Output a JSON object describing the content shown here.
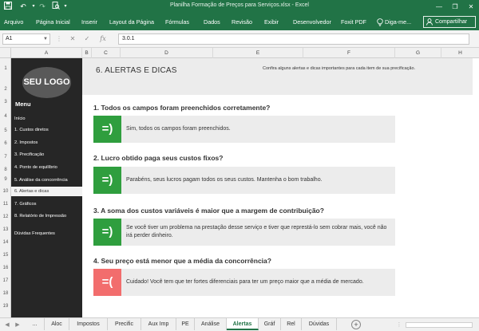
{
  "window": {
    "title": "Planilha Formação de Preços para Serviços.xlsx - Excel",
    "minimize": "—",
    "restore": "❐",
    "close": "✕"
  },
  "ribbon": {
    "tabs": [
      "Arquivo",
      "Página Inicial",
      "Inserir",
      "Layout da Página",
      "Fórmulas",
      "Dados",
      "Revisão",
      "Exibir",
      "Desenvolvedor",
      "Foxit PDF",
      "Diga-me..."
    ],
    "share_label": "Compartilhar"
  },
  "formula_bar": {
    "name_box": "A1",
    "value": "3.0.1"
  },
  "columns": [
    "A",
    "B",
    "C",
    "D",
    "E",
    "F",
    "G",
    "H"
  ],
  "rows": [
    "1",
    "2",
    "3",
    "4",
    "5",
    "6",
    "7",
    "8",
    "9",
    "10",
    "11",
    "12",
    "13",
    "14",
    "15",
    "16",
    "17",
    "18",
    "19"
  ],
  "menu": {
    "logo": "SEU LOGO",
    "title": "Menu",
    "items": [
      "Início",
      "1. Custos diretos",
      "2. Impostos",
      "3. Precificação",
      "4. Ponto de equilíbrio",
      "5. Análise da concorrência",
      "6. Alertas e dicas",
      "7. Gráficos",
      "8. Relatório de Impressão",
      "Dúvidas Frequentes"
    ]
  },
  "header": {
    "title": "6. ALERTAS E DICAS",
    "subtitle": "Confira alguns alertas e dicas importantes para cada item de sua precificação."
  },
  "alerts": [
    {
      "question": "1. Todos os campos foram preenchidos corretamente?",
      "badge": "=)",
      "status": "ok",
      "answer": "Sim, todos os campos foram preenchidos."
    },
    {
      "question": "2. Lucro obtido paga seus custos fixos?",
      "badge": "=)",
      "status": "ok",
      "answer": "Parabéns, seus lucros pagam todos os seus custos. Mantenha o bom trabalho."
    },
    {
      "question": "3. A soma dos custos variáveis é maior que a margem de contribuição?",
      "badge": "=)",
      "status": "ok",
      "answer": "Se você tiver um problema na prestação desse serviço e tiver que represtá-lo sem cobrar mais, você não irá perder dinheiro."
    },
    {
      "question": "4. Seu preço está menor que a média da concorrência?",
      "badge": "=(",
      "status": "warning",
      "answer": "Cuidado! Você tem que ter fortes diferenciais para ter um preço maior que a média de mercado."
    }
  ],
  "sheet_tabs": [
    "...",
    "Aloc",
    "Impostos",
    "Precific",
    "Aux Imp",
    "PE",
    "Análise",
    "Alertas",
    "Gráf",
    "Rel",
    "Dúvidas"
  ],
  "active_tab": "Alertas",
  "colors": {
    "excel_green": "#217346",
    "ok_green": "#2f9e3e",
    "warning_red": "#f26d6d",
    "menu_bg": "#262626"
  },
  "icons": [
    "save-icon",
    "undo-icon",
    "redo-icon",
    "print-preview-icon",
    "lightbulb-icon",
    "user-icon",
    "cancel-icon",
    "check-icon",
    "function-icon",
    "add-sheet-icon"
  ]
}
